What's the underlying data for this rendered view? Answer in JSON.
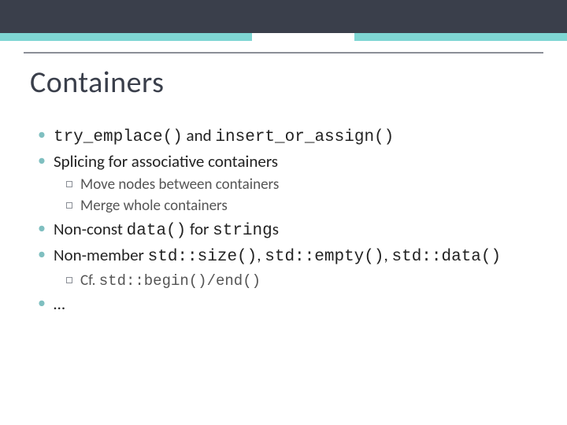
{
  "title": "Containers",
  "bullets": {
    "b0": {
      "code0": "try_emplace()",
      "mid": " and ",
      "code1": "insert_or_assign()"
    },
    "b1": "Splicing for associative containers",
    "b1sub": {
      "s0": "Move nodes between containers",
      "s1": "Merge whole containers"
    },
    "b2": {
      "pre": "Non-const ",
      "code0": "data()",
      "mid": " for ",
      "code1": "string",
      "post": "s"
    },
    "b3": {
      "pre": "Non-member ",
      "code0": "std::size()",
      "sep0": ", ",
      "code1": "std::empty()",
      "sep1": ", ",
      "code2": "std::data()"
    },
    "b3sub": {
      "pre": "Cf. ",
      "code0": "std::begin()/end()"
    },
    "b4": "…"
  }
}
